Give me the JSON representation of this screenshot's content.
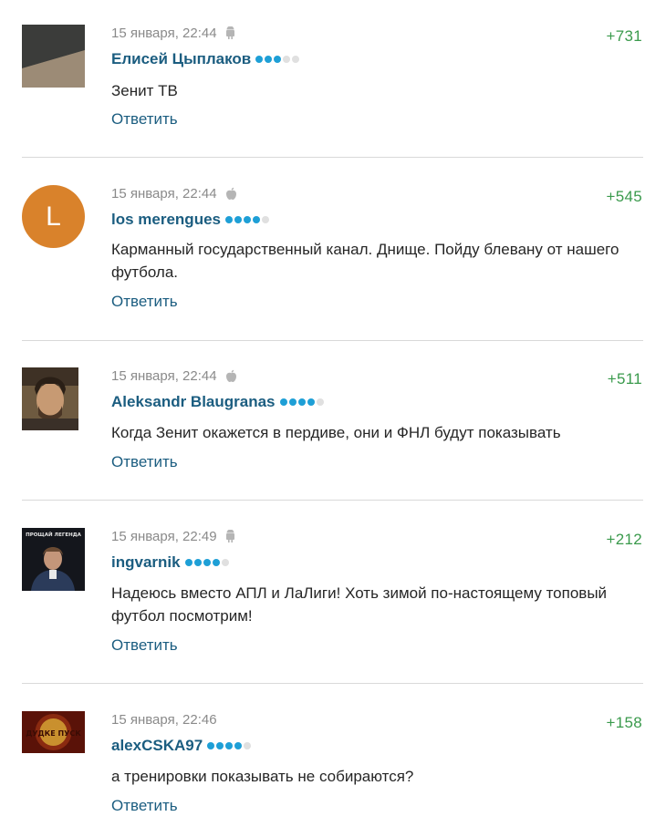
{
  "reply_label": "Ответить",
  "comments": [
    {
      "timestamp": "15 января, 22:44",
      "device": "android-icon",
      "rating": "+731",
      "author": "Елисей Цыплаков",
      "level": 3,
      "text": "Зенит ТВ",
      "avatar": "photo"
    },
    {
      "timestamp": "15 января, 22:44",
      "device": "apple-icon",
      "rating": "+545",
      "author": "los merengues",
      "level": 4,
      "text": "Карманный государственный канал. Днище. Пойду блевану от нашего футбола.",
      "avatar": "letter",
      "avatar_letter": "L"
    },
    {
      "timestamp": "15 января, 22:44",
      "device": "apple-icon",
      "rating": "+511",
      "author": "Aleksandr Blaugranas",
      "level": 4,
      "text": "Когда Зенит окажется в пердиве, они и ФНЛ будут показывать",
      "avatar": "photo"
    },
    {
      "timestamp": "15 января, 22:49",
      "device": "android-icon",
      "rating": "+212",
      "author": "ingvarnik",
      "level": 4,
      "text": "Надеюсь вместо АПЛ и ЛаЛиги! Хоть зимой по-настоящему топовый футбол посмотрим!",
      "avatar": "photo",
      "avatar_caption": "ПРОЩАЙ ЛЕГЕНДА"
    },
    {
      "timestamp": "15 января, 22:46",
      "device": "none",
      "rating": "+158",
      "author": "alexCSKA97",
      "level": 4,
      "text": "а тренировки показывать не собираются?",
      "avatar": "logo",
      "avatar_caption": "ДУДКЕ ПУСК"
    }
  ],
  "colors": {
    "author": "#1b5d80",
    "rating_positive": "#3a9a4c",
    "level_dot_on": "#1e9fd6",
    "level_dot_off": "#e0e0e0",
    "avatar_letter_bg": "#d9822b"
  }
}
